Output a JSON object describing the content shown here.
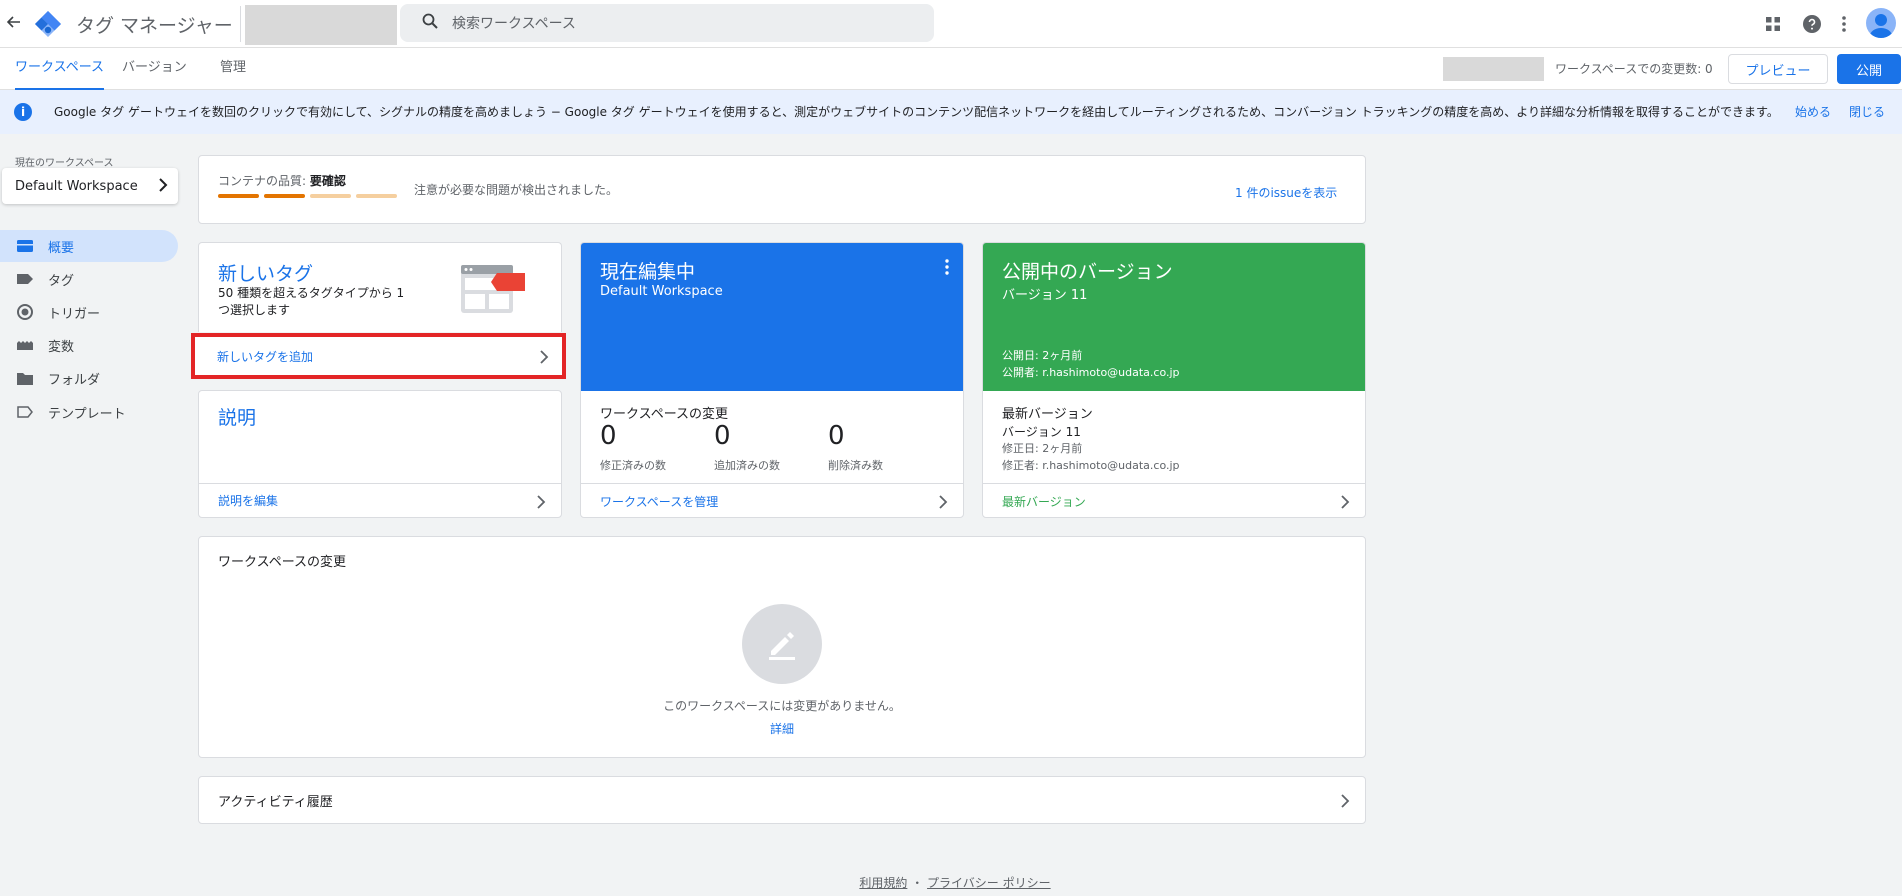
{
  "app": {
    "title": "タグ マネージャー"
  },
  "search": {
    "placeholder": "検索ワークスペース"
  },
  "tabs": [
    {
      "label": "ワークスペース"
    },
    {
      "label": "バージョン"
    },
    {
      "label": "管理"
    }
  ],
  "workspace_changes_count": "ワークスペースでの変更数: 0",
  "buttons": {
    "preview": "プレビュー",
    "publish": "公開"
  },
  "banner": {
    "text": "Google タグ ゲートウェイを数回のクリックで有効にして、シグナルの精度を高めましょう − Google タグ ゲートウェイを使用すると、測定がウェブサイトのコンテンツ配信ネットワークを経由してルーティングされるため、コンバージョン トラッキングの精度を高め、より詳細な分析情報を取得することができます。",
    "start": "始める",
    "close": "閉じる"
  },
  "sidebar": {
    "current_workspace_label": "現在のワークスペース",
    "workspace_name": "Default Workspace",
    "items": [
      {
        "label": "概要",
        "icon": "overview-icon"
      },
      {
        "label": "タグ",
        "icon": "tag-icon"
      },
      {
        "label": "トリガー",
        "icon": "trigger-icon"
      },
      {
        "label": "変数",
        "icon": "variable-icon"
      },
      {
        "label": "フォルダ",
        "icon": "folder-icon"
      },
      {
        "label": "テンプレート",
        "icon": "template-icon"
      }
    ]
  },
  "quality": {
    "label": "コンテナの品質:",
    "status": "要確認",
    "message": "注意が必要な問題が検出されました。",
    "link": "1 件のissueを表示",
    "colors": [
      "#e37400",
      "#e37400",
      "#f5cf9f",
      "#f5cf9f"
    ]
  },
  "new_tag": {
    "title": "新しいタグ",
    "description": "50 種類を超えるタグタイプから 1 つ選択します",
    "add_link": "新しいタグを追加"
  },
  "description_card": {
    "title": "説明",
    "edit_link": "説明を編集"
  },
  "editing": {
    "title": "現在編集中",
    "workspace": "Default Workspace",
    "changes_heading": "ワークスペースの変更",
    "stats": [
      {
        "value": "0",
        "label": "修正済みの数"
      },
      {
        "value": "0",
        "label": "追加済みの数"
      },
      {
        "value": "0",
        "label": "削除済み数"
      }
    ],
    "manage_link": "ワークスペースを管理",
    "color": "#1a73e8"
  },
  "published": {
    "title": "公開中のバージョン",
    "version": "バージョン 11",
    "date": "公開日: 2ヶ月前",
    "by": "公開者: r.hashimoto@udata.co.jp",
    "latest_heading": "最新バージョン",
    "latest_version": "バージョン 11",
    "latest_date": "修正日: 2ヶ月前",
    "latest_by": "修正者: r.hashimoto@udata.co.jp",
    "latest_link": "最新バージョン",
    "color": "#34a853"
  },
  "changes_card": {
    "heading": "ワークスペースの変更",
    "empty_message": "このワークスペースには変更がありません。",
    "details_link": "詳細"
  },
  "activity": {
    "heading": "アクティビティ履歴"
  },
  "footer": {
    "terms": "利用規約",
    "separator": "・",
    "privacy": "プライバシー ポリシー"
  }
}
